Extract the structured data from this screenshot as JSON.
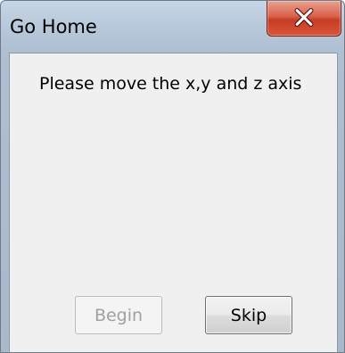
{
  "window": {
    "title": "Go Home"
  },
  "message": "Please move the x,y and z axis",
  "buttons": {
    "begin_label": "Begin",
    "skip_label": "Skip",
    "begin_disabled": true
  },
  "icons": {
    "close": "close-icon"
  },
  "colors": {
    "close_button": "#c53d24",
    "client_background": "#f0f0f0",
    "disabled_text": "#a0a0a0"
  }
}
